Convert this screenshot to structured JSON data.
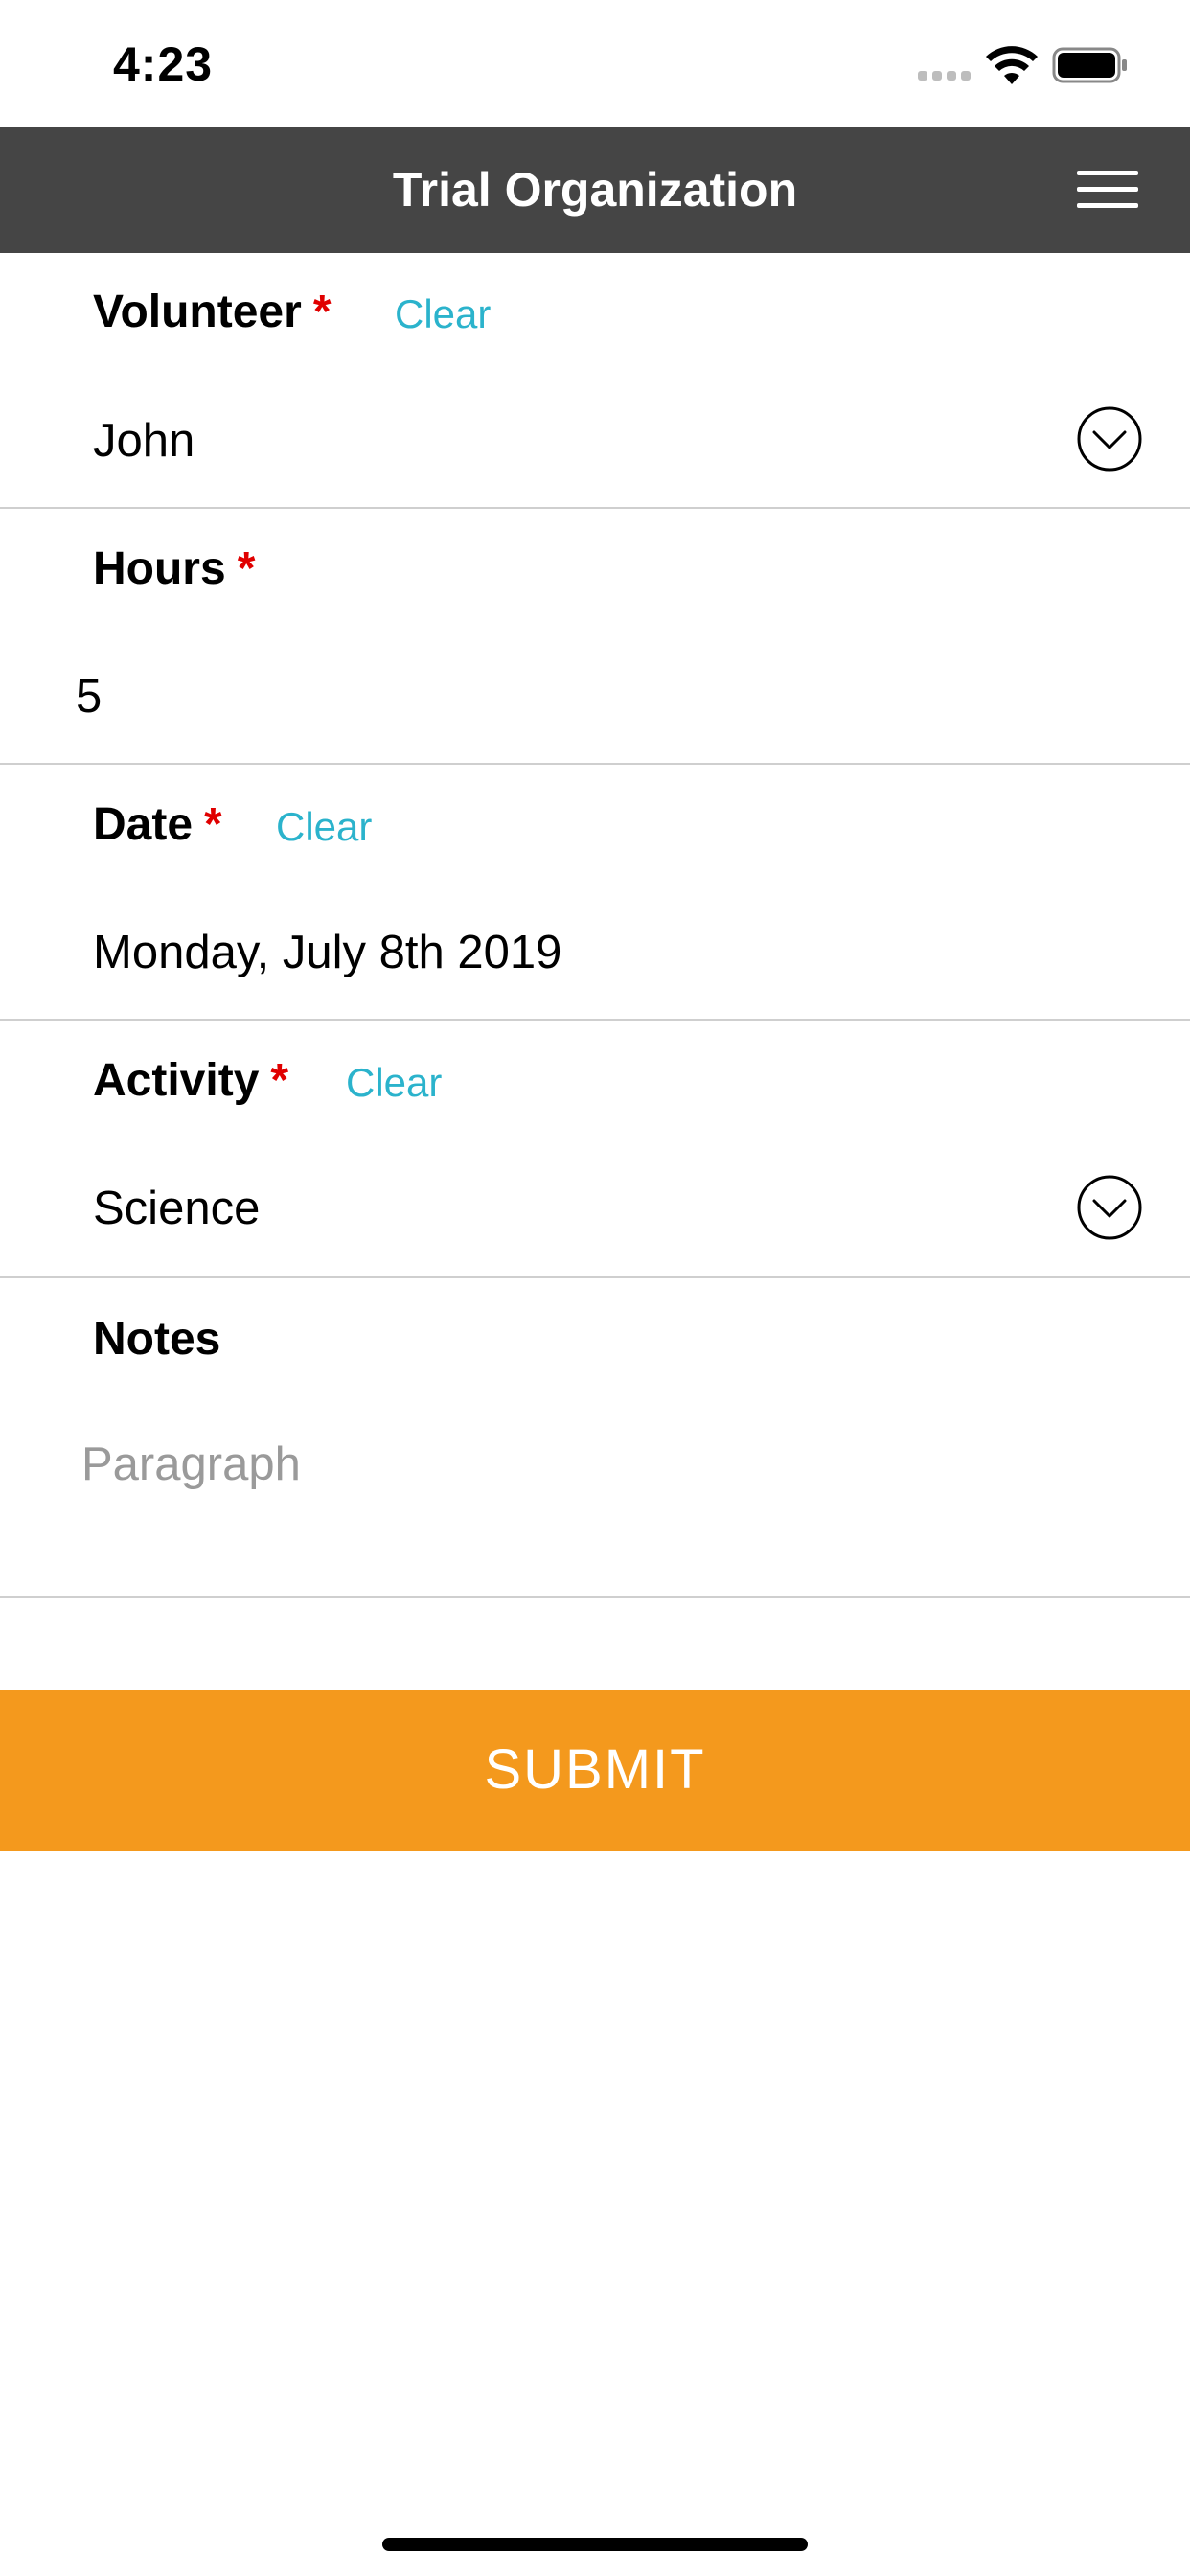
{
  "status_bar": {
    "time": "4:23"
  },
  "header": {
    "title": "Trial Organization",
    "menu_icon": "hamburger-menu-icon"
  },
  "form": {
    "volunteer": {
      "label": "Volunteer",
      "required_mark": "*",
      "clear_label": "Clear",
      "value": "John",
      "icon": "chevron-down-circle-icon"
    },
    "hours": {
      "label": "Hours",
      "required_mark": "*",
      "value": "5"
    },
    "date": {
      "label": "Date",
      "required_mark": "*",
      "clear_label": "Clear",
      "value": "Monday, July 8th 2019"
    },
    "activity": {
      "label": "Activity",
      "required_mark": "*",
      "clear_label": "Clear",
      "value": "Science",
      "icon": "chevron-down-circle-icon"
    },
    "notes": {
      "label": "Notes",
      "placeholder": "Paragraph"
    },
    "submit_label": "SUBMIT"
  },
  "colors": {
    "header_bg": "#454545",
    "accent_link": "#2bb3cc",
    "required": "#e00000",
    "submit_bg": "#f4991d",
    "divider": "#cfcfcf"
  }
}
